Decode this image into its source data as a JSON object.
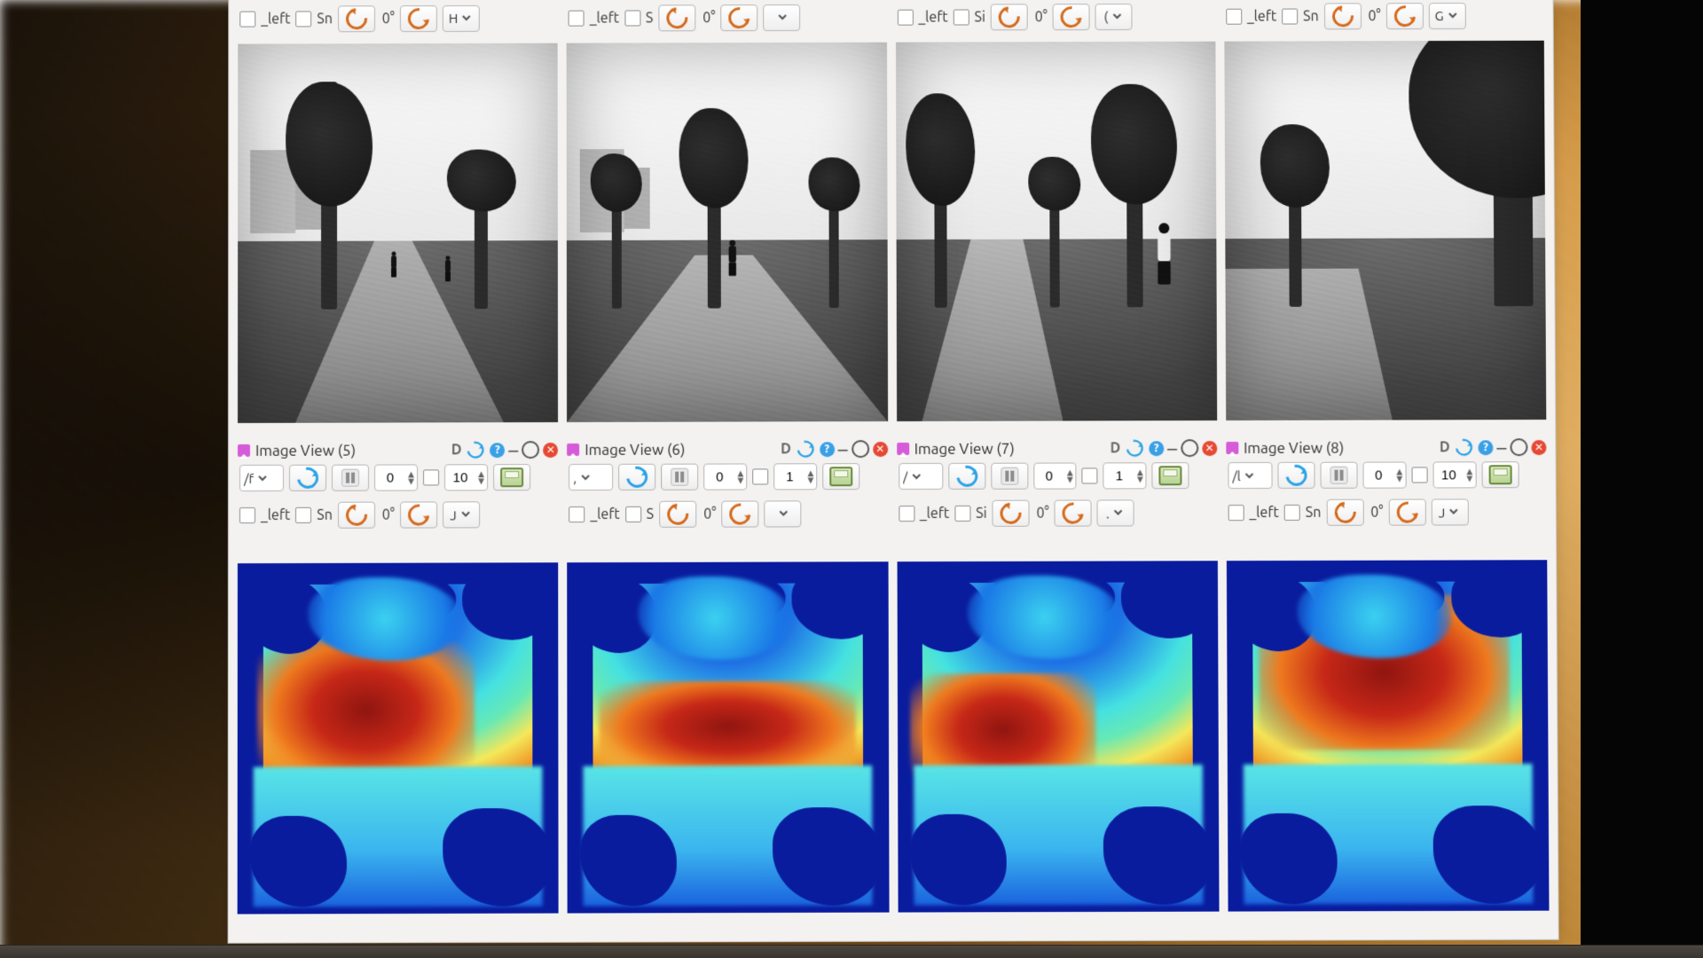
{
  "top_toolbars": [
    {
      "left_label": "_left",
      "sm_label": "Sn",
      "deg": "0°",
      "sel": "H"
    },
    {
      "left_label": "_left",
      "sm_label": "S",
      "deg": "0°",
      "sel": ""
    },
    {
      "left_label": "_left",
      "sm_label": "Si",
      "deg": "0°",
      "sel": "("
    },
    {
      "left_label": "_left",
      "sm_label": "Sn",
      "deg": "0°",
      "sel": "G"
    }
  ],
  "camera_alts": [
    "grayscale camera: park walkway, tall tree center-left, buildings far left, overcast sky",
    "grayscale camera: park, sparse tree center, brick path foreground, city skyline behind",
    "grayscale camera: straight brick path between grass, trees both sides, person right",
    "grayscale camera: shaded park, thick trunk far right, path curving left"
  ],
  "panels": [
    {
      "title": "Image View (5)",
      "D": "D",
      "topic": "/f",
      "spin1": "0",
      "spin2": "10",
      "left_label": "_left",
      "sm_label": "Sn",
      "deg": "0°",
      "sel": "J",
      "depth_alt": "depth colormap: warm blob upper-left and center, cool cyan lower"
    },
    {
      "title": "Image View (6)",
      "D": "D",
      "topic": ",",
      "spin1": "0",
      "spin2": "1",
      "left_label": "_left",
      "sm_label": "S",
      "deg": "0°",
      "sel": "",
      "depth_alt": "depth colormap: cool sky top, narrow hot red band mid, cyan basin lower"
    },
    {
      "title": "Image View (7)",
      "D": "D",
      "topic": "/",
      "spin1": "0",
      "spin2": "1",
      "left_label": "_left",
      "sm_label": "Si",
      "deg": "0°",
      "sel": ".",
      "depth_alt": "depth colormap: cyan-yellow upper, deep red left band, cyan basin lower"
    },
    {
      "title": "Image View (8)",
      "D": "D",
      "topic": "/l",
      "spin1": "0",
      "spin2": "10",
      "left_label": "_left",
      "sm_label": "Sn",
      "deg": "0°",
      "sel": "J",
      "depth_alt": "depth colormap: large red-orange mass upper, cyan basin lower, blue margins"
    }
  ]
}
